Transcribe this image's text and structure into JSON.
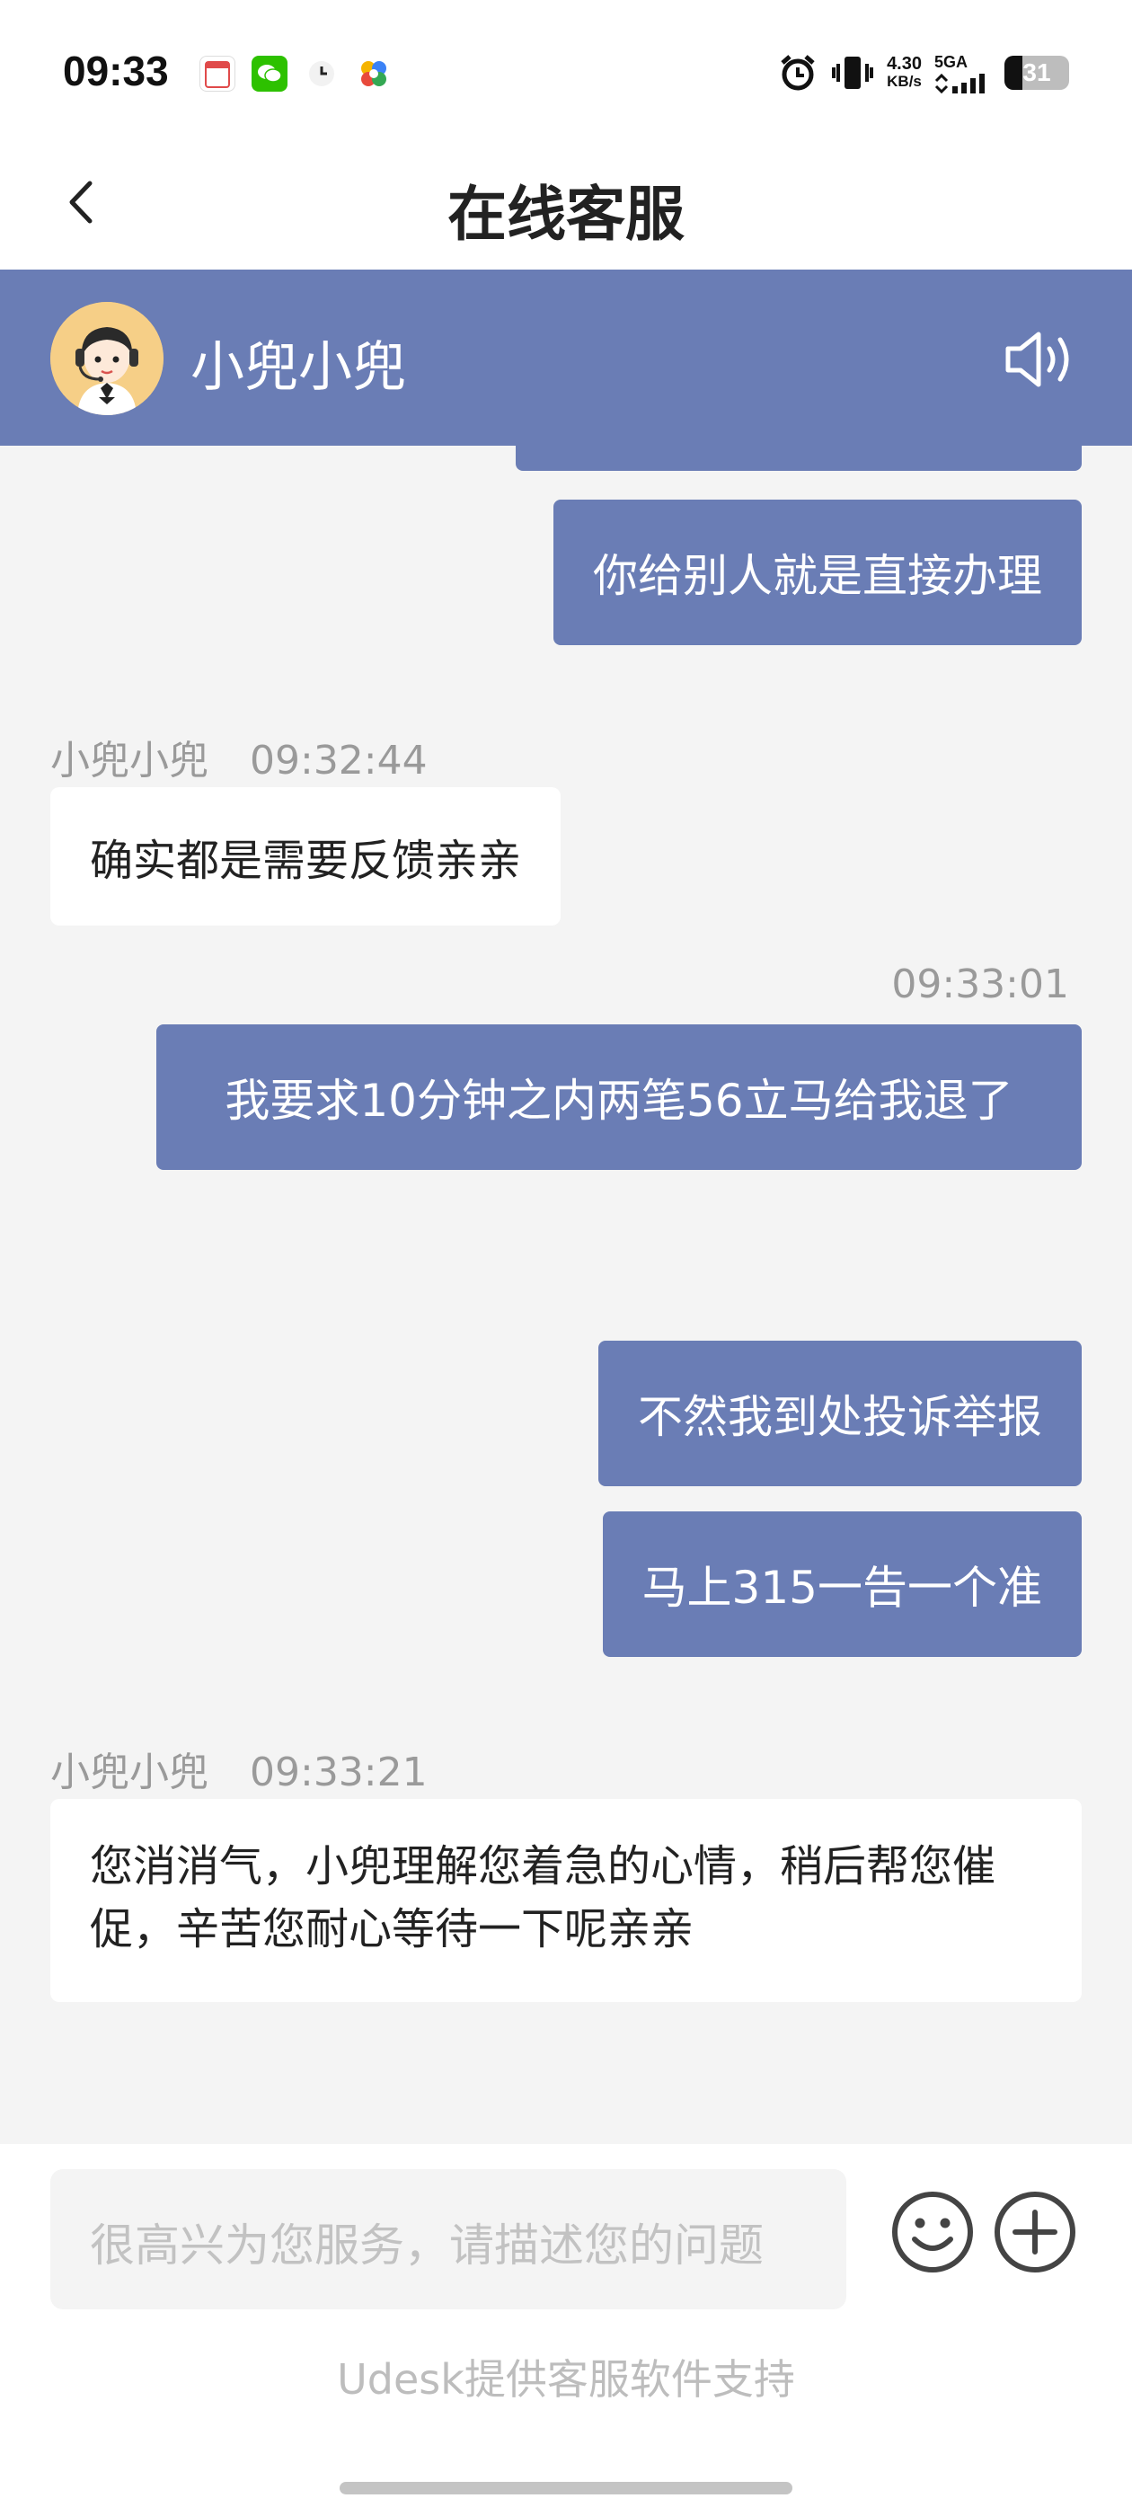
{
  "status_bar": {
    "time": "09:33",
    "net_speed_value": "4.30",
    "net_speed_unit": "KB/s",
    "network_type": "5GA",
    "battery": "31"
  },
  "header": {
    "title": "在线客服"
  },
  "agent": {
    "name": "小兜小兜"
  },
  "messages": [
    {
      "from": "user",
      "text": "你给别人就是直接办理"
    },
    {
      "from": "agent",
      "sender": "小兜小兜",
      "time": "09:32:44",
      "text": "确实都是需要反馈亲亲"
    },
    {
      "from": "user",
      "time": "09:33:01",
      "text": "我要求10分钟之内两笔56立马给我退了"
    },
    {
      "from": "user",
      "text": "不然我到处投诉举报"
    },
    {
      "from": "user",
      "text": "马上315一告一个准"
    },
    {
      "from": "agent",
      "sender": "小兜小兜",
      "time": "09:33:21",
      "text": "您消消气，小兜理解您着急的心情，稍后帮您催促，辛苦您耐心等待一下呢亲亲"
    }
  ],
  "input": {
    "placeholder": "很高兴为您服务，请描述您的问题"
  },
  "footer": {
    "powered_by": "Udesk提供客服软件支持"
  },
  "colors": {
    "brand": "#6a7db5",
    "background": "#f4f4f4"
  }
}
